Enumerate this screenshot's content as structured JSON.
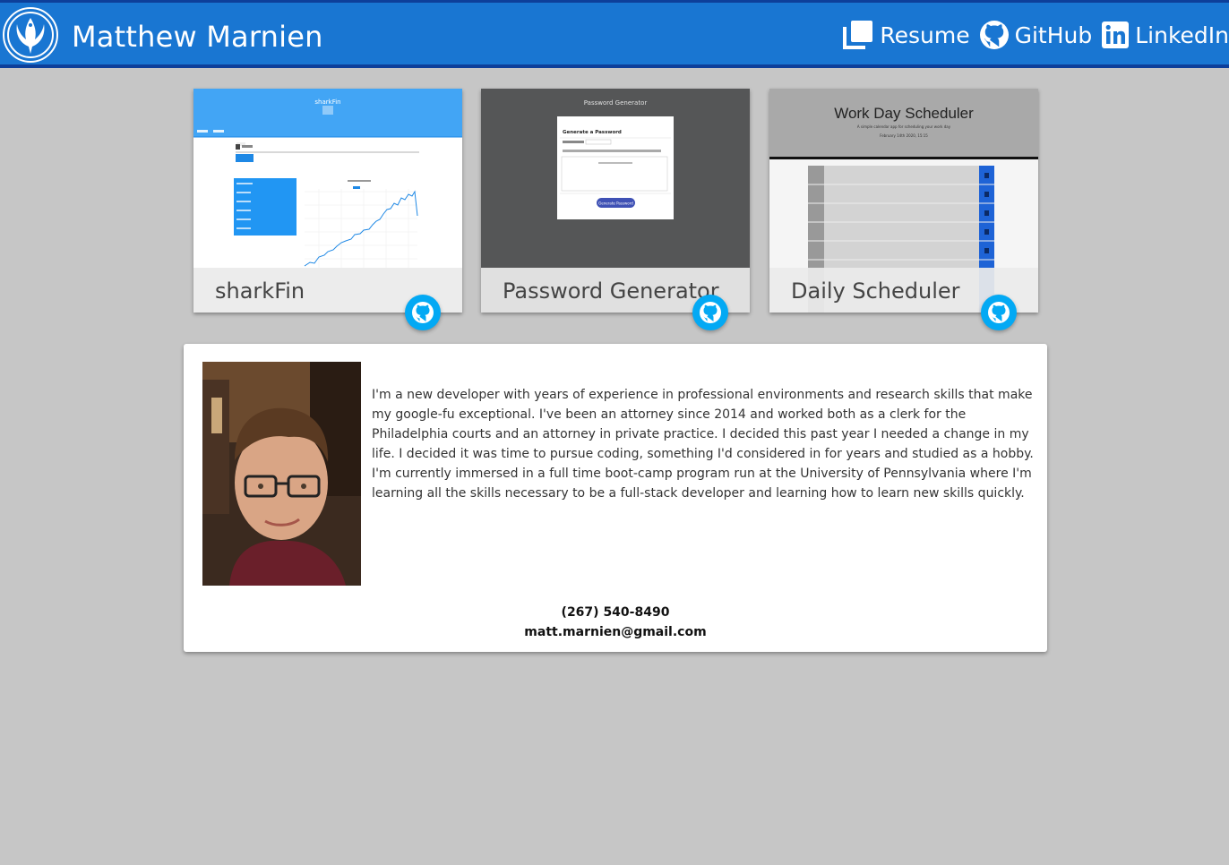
{
  "header": {
    "title": "Matthew Marnien",
    "nav": [
      {
        "label": "Resume",
        "icon": "documents-icon"
      },
      {
        "label": "GitHub",
        "icon": "github-icon"
      },
      {
        "label": "LinkedIn",
        "icon": "linkedin-icon"
      }
    ]
  },
  "projects": [
    {
      "title": "sharkFin",
      "screenshot_heading": "sharkFin"
    },
    {
      "title": "Password Generator",
      "screenshot_heading": "Password Generator",
      "screenshot_box_title": "Generate a Password",
      "screenshot_button": "Generate Password"
    },
    {
      "title": "Daily Scheduler",
      "screenshot_heading": "Work Day Scheduler",
      "screenshot_subtitle": "A simple calendar app for scheduling your work day",
      "screenshot_date": "February 14th 2020, 15:15"
    }
  ],
  "about": {
    "bio": "I'm a new developer with years of experience in professional environments and research skills that make my google-fu exceptional. I've been an attorney since 2014 and worked both as a clerk for the Philadelphia courts and an attorney in private practice. I decided this past year I needed a change in my life. I decided it was time to pursue coding, something I'd considered in for years and studied as a hobby. I'm currently immersed in a full time boot-camp program run at the University of Pennsylvania where I'm learning all the skills necessary to be a full-stack developer and learning how to learn new skills quickly.",
    "phone": "(267) 540-8490",
    "email": "matt.marnien@gmail.com"
  },
  "colors": {
    "header": "#1976d2",
    "fab": "#03a9f4",
    "background": "#c6c6c6"
  }
}
